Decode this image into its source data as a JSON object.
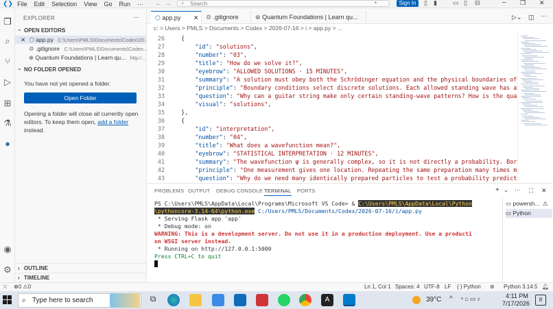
{
  "window": {
    "menu": [
      "File",
      "Edit",
      "Selection",
      "View",
      "Go",
      "Run",
      "···"
    ],
    "search_placeholder": "Search",
    "signin_label": "Sign In"
  },
  "sidebar": {
    "title": "EXPLORER",
    "open_editors_label": "OPEN EDITORS",
    "open_editors": [
      {
        "name": "app.py",
        "path": "C:\\Users\\PMLS\\Documents\\Codex\\20..."
      },
      {
        "name": ".gitignore",
        "path": "C:\\Users\\PMLS\\Documents\\Codex..."
      },
      {
        "name": "Quantum Foundations | Learn qu...",
        "path": "http:/..."
      }
    ],
    "no_folder_label": "NO FOLDER OPENED",
    "no_folder_text": "You have not yet opened a folder.",
    "open_folder_button": "Open Folder",
    "info_text_1": "Opening a folder will close all currently open",
    "info_text_2": "editors. To keep them open,",
    "add_folder_link": "add a folder",
    "info_text_3": "instead.",
    "outline_label": "OUTLINE",
    "timeline_label": "TIMELINE"
  },
  "tabs": [
    {
      "label": "app.py"
    },
    {
      "label": ".gitignore"
    },
    {
      "label": "Quantum Foundations | Learn qu..."
    }
  ],
  "breadcrumb": "c: > Users > PMLS > Documents > Codex > 2026-07-16 > i > app.py > ...",
  "editor": {
    "lines": [
      {
        "n": "26",
        "t": "    {"
      },
      {
        "n": "27",
        "k": "\"id\"",
        "v": "\"solutions\","
      },
      {
        "n": "28",
        "k": "\"number\"",
        "v": "\"03\","
      },
      {
        "n": "29",
        "k": "\"title\"",
        "v": "\"How do we solve it?\","
      },
      {
        "n": "30",
        "k": "\"eyebrow\"",
        "v": "\"ALLOWED SOLUTIONS · 15 MINUTES\","
      },
      {
        "n": "31",
        "k": "\"summary\"",
        "v": "\"A solution must obey both the Schrödinger equation and the physical boundaries of"
      },
      {
        "n": "32",
        "k": "\"principle\"",
        "v": "\"Boundary conditions select discrete solutions. Each allowed standing wave has a"
      },
      {
        "n": "33",
        "k": "\"question\"",
        "v": "\"Why can a guitar string make only certain standing-wave patterns? How is the qua"
      },
      {
        "n": "34",
        "k": "\"visual\"",
        "v": "\"solutions\","
      },
      {
        "n": "35",
        "t": "    },"
      },
      {
        "n": "36",
        "t": "    {"
      },
      {
        "n": "37",
        "k": "\"id\"",
        "v": "\"interpretation\","
      },
      {
        "n": "38",
        "k": "\"number\"",
        "v": "\"04\","
      },
      {
        "n": "39",
        "k": "\"title\"",
        "v": "\"What does a wavefunction mean?\","
      },
      {
        "n": "40",
        "k": "\"eyebrow\"",
        "v": "\"STATISTICAL INTERPRETATION · 12 MINUTES\","
      },
      {
        "n": "41",
        "k": "\"summary\"",
        "v": "\"The wavefunction ψ is generally complex, so it is not directly a probability. Born's rule"
      },
      {
        "n": "42",
        "k": "\"principle\"",
        "v": "\"One measurement gives one location. Repeating the same preparation many times makes the"
      },
      {
        "n": "43",
        "k": "\"question\"",
        "v": "\"Why do we need many identically prepared particles to test a probability predict"
      }
    ]
  },
  "panel": {
    "tabs": [
      "PROBLEMS",
      "OUTPUT",
      "DEBUG CONSOLE",
      "TERMINAL",
      "PORTS"
    ],
    "terminal": {
      "prompt": "PS C:\\Users\\PMLS\\AppData\\Local\\Programs\\Microsoft VS Code> & ",
      "cmd1": "C:\\Users\\PMLS\\AppData\\Local\\Python",
      "cmd2": "\\pythoncore-3.14-64\\python.exe",
      "arg": " C:/Users/PMLS/Documents/Codex/2026-07-16/i/app.py",
      "l3": " * Serving Flask app 'app'",
      "l4": " * Debug mode: on",
      "warn1": "WARNING: This is a development server. Do not use it in a production deployment. Use a producti",
      "warn2": "on WSGI server instead.",
      "l7": " * Running on http://127.0.0.1:5000",
      "l8": "Press CTRL+C to quit"
    },
    "terminals": [
      "powersh...",
      "Python"
    ]
  },
  "status": {
    "errors": "0",
    "warnings": "0",
    "position": "Ln 1, Col 1",
    "spaces": "Spaces: 4",
    "encoding": "UTF-8",
    "eol": "LF",
    "language": "{ } Python",
    "python_version": "Python 3.14.5"
  },
  "taskbar": {
    "search_placeholder": "Type here to search",
    "weather": "39°C",
    "time": "4:11 PM",
    "date": "7/17/2026",
    "notifications": "8"
  }
}
